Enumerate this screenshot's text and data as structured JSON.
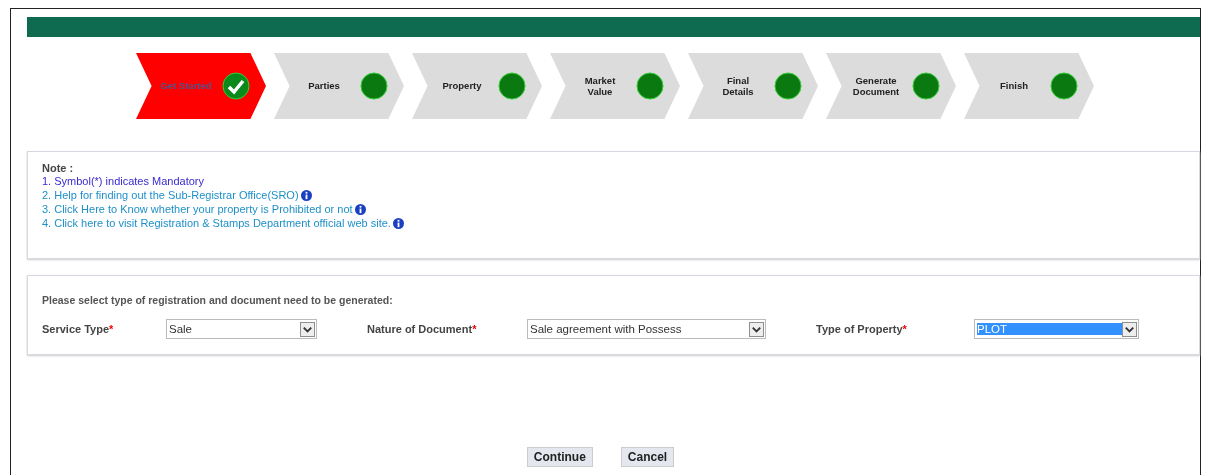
{
  "steps": [
    {
      "label": "Get Started",
      "selected": true,
      "completed": true
    },
    {
      "label": "Parties",
      "selected": false,
      "completed": false
    },
    {
      "label": "Property",
      "selected": false,
      "completed": false
    },
    {
      "label": "Market Value",
      "selected": false,
      "completed": false
    },
    {
      "label": "Final Details",
      "selected": false,
      "completed": false
    },
    {
      "label": "Generate Document",
      "selected": false,
      "completed": false
    },
    {
      "label": "Finish",
      "selected": false,
      "completed": false
    }
  ],
  "note": {
    "title": "Note :",
    "items": [
      {
        "text": "1. Symbol(*) indicates Mandatory",
        "kind": "text",
        "info": false
      },
      {
        "text": "2. Help for finding out the Sub-Registrar Office(SRO)",
        "kind": "link",
        "info": true
      },
      {
        "text": "3. Click Here to Know whether your property is Prohibited or not",
        "kind": "link",
        "info": true
      },
      {
        "text": "4. Click here to visit Registration & Stamps Department official web site.",
        "kind": "link",
        "info": true
      }
    ]
  },
  "form": {
    "instruction": "Please select type of registration and document need to be generated:",
    "fields": [
      {
        "label": "Service Type",
        "required_mark": "*",
        "value": "Sale",
        "highlighted": false
      },
      {
        "label": "Nature of Document",
        "required_mark": "*",
        "value": "Sale agreement with Possess",
        "highlighted": false
      },
      {
        "label": "Type of Property",
        "required_mark": "*",
        "value": "PLOT",
        "highlighted": true
      }
    ]
  },
  "buttons": [
    "Continue",
    "Cancel"
  ]
}
